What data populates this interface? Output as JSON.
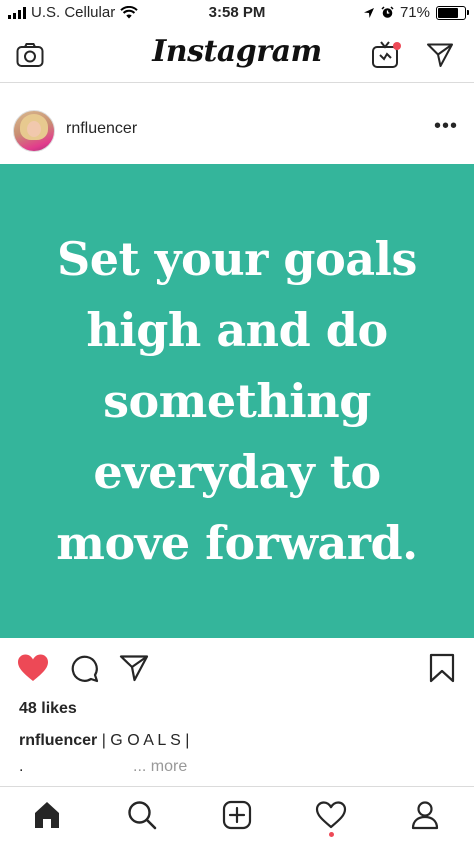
{
  "status_bar": {
    "carrier": "U.S. Cellular",
    "time": "3:58 PM",
    "battery_percent": "71%",
    "battery_level": 0.71,
    "icons": [
      "signal-icon",
      "wifi-icon",
      "location-icon",
      "alarm-icon",
      "battery-icon"
    ]
  },
  "header": {
    "logo": "Instagram",
    "icons": [
      "camera-icon",
      "igtv-icon",
      "direct-message-icon"
    ],
    "igtv_badge_color": "#ed4956"
  },
  "post": {
    "username": "rnfluencer",
    "more_label": "•••",
    "image": {
      "background_color": "#34b59b",
      "text_color": "#ffffff",
      "quote_lines": [
        "Set your goals",
        "high and do",
        "something",
        "everyday to",
        "move forward."
      ]
    },
    "actions": {
      "icons": [
        "like-heart-icon",
        "comment-icon",
        "share-icon",
        "bookmark-icon"
      ],
      "liked": true,
      "like_color": "#ed4956"
    },
    "likes": "48 likes",
    "caption": {
      "username": "rnfluencer",
      "text": " | G O A L S |",
      "second_line": ".",
      "more": "... more"
    }
  },
  "tab_bar": {
    "icons": [
      "home-icon",
      "search-icon",
      "new-post-icon",
      "activity-heart-icon",
      "profile-icon"
    ],
    "active": "home",
    "activity_dot_color": "#ed4956"
  }
}
